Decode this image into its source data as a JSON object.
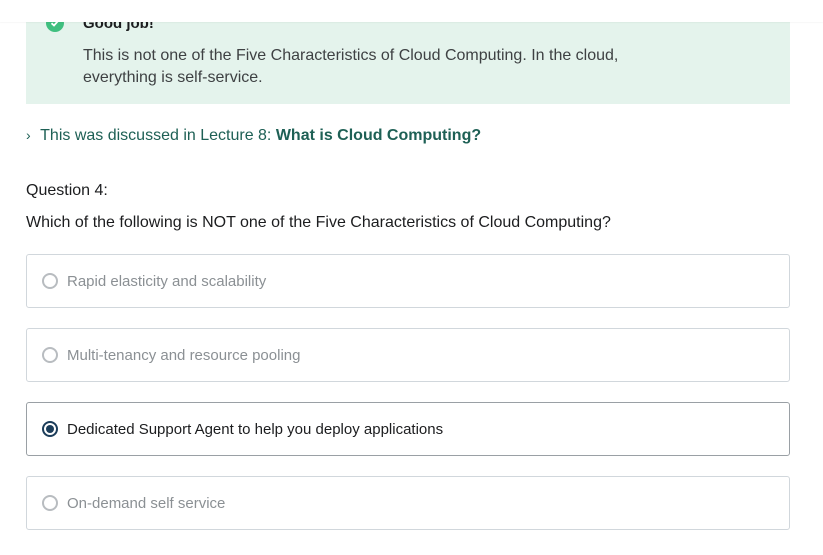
{
  "feedback": {
    "title": "Good job!",
    "message": "This is not one of the Five Characteristics of Cloud Computing. In the cloud, everything is self-service.",
    "icon": "check-circle-icon",
    "color": "#3fbf7f",
    "background": "#e4f3ec"
  },
  "lecture": {
    "prefix": "This was discussed in Lecture 8:",
    "title": "What is Cloud Computing?",
    "icon": "chevron-right-icon"
  },
  "question": {
    "number_label": "Question 4:",
    "text": "Which of the following is NOT one of the Five Characteristics of Cloud Computing?",
    "options": [
      {
        "label": "Rapid elasticity and scalability",
        "selected": false
      },
      {
        "label": "Multi-tenancy and resource pooling",
        "selected": false
      },
      {
        "label": "Dedicated Support Agent to help you deploy applications",
        "selected": true
      },
      {
        "label": "On-demand self service",
        "selected": false
      }
    ]
  },
  "colors": {
    "link": "#1e6055",
    "selected_radio": "#1c3d5a"
  }
}
